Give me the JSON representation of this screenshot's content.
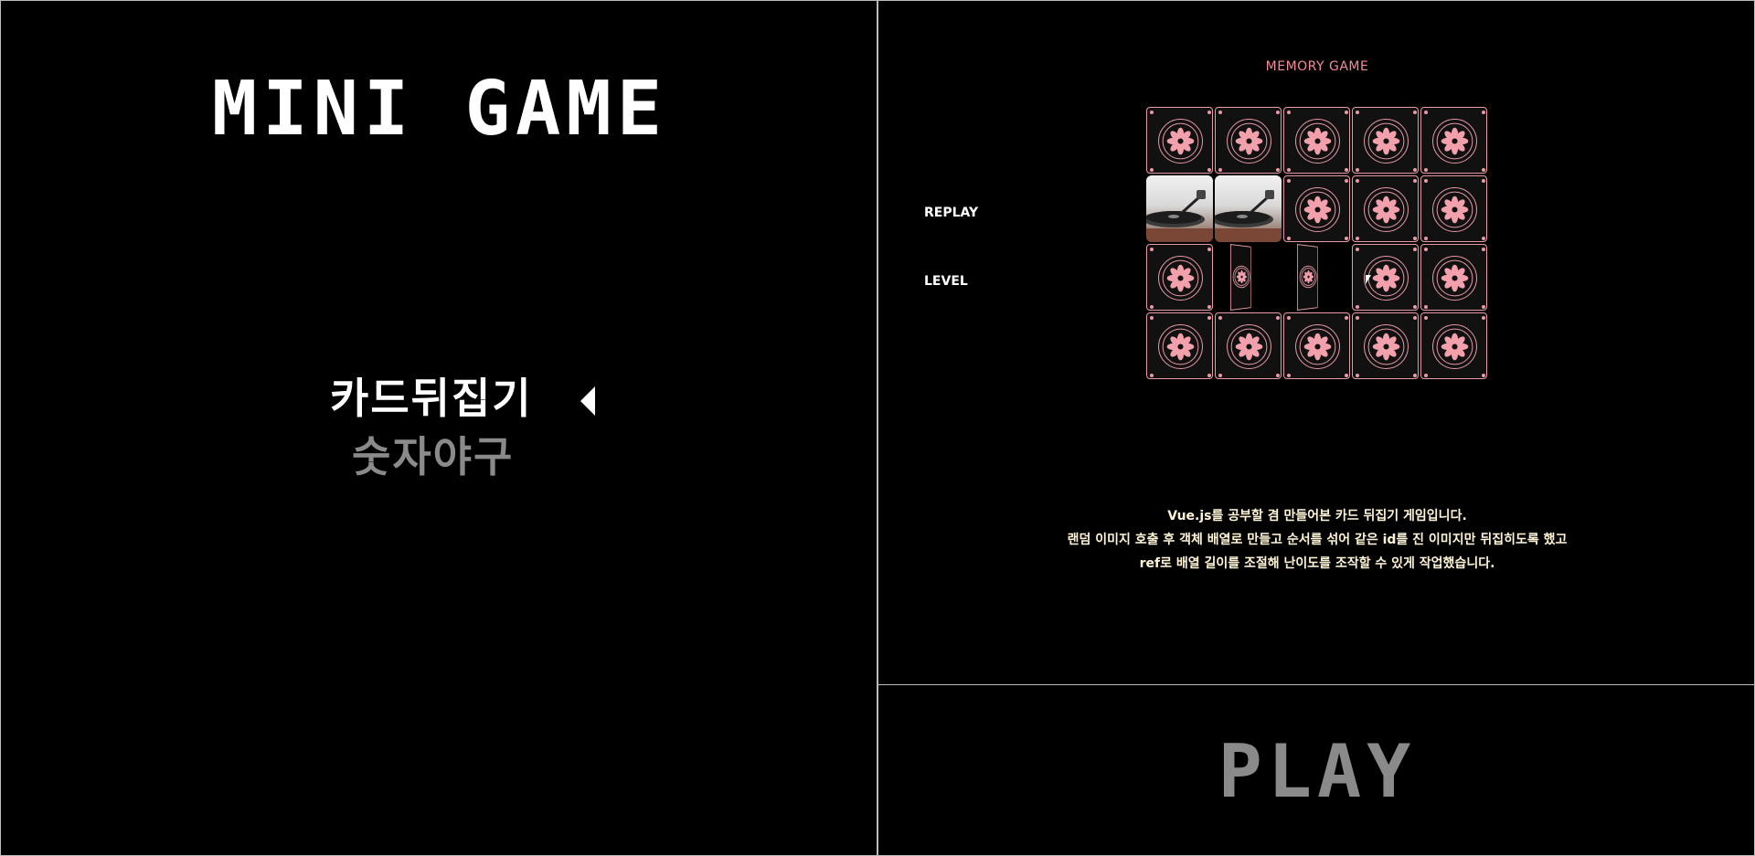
{
  "menu": {
    "title": "MINI GAME",
    "items": [
      {
        "label": "카드뒤집기",
        "selected": true
      },
      {
        "label": "숫자야구",
        "selected": false
      }
    ]
  },
  "game": {
    "title": "MEMORY GAME",
    "replay_label": "REPLAY",
    "level_label": "LEVEL",
    "grid": {
      "columns": 5,
      "rows": 4
    },
    "revealed_cards": [
      {
        "row": 2,
        "col": 1,
        "image": "turntable"
      },
      {
        "row": 2,
        "col": 2,
        "image": "turntable"
      }
    ],
    "flipping_cards": [
      {
        "row": 3,
        "col": 2
      },
      {
        "row": 3,
        "col": 3
      }
    ],
    "description": [
      "Vue.js를 공부할 겸 만들어본 카드 뒤집기 게임입니다.",
      "랜덤 이미지 호출 후 객체 배열로 만들고 순서를 섞어 같은 id를 진 이미지만 뒤집히도록 했고",
      "ref로 배열 길이를 조절해 난이도를 조작할 수 있게 작업했습니다."
    ],
    "colors": {
      "accent": "#f38b9b",
      "card_border": "#e89aa6",
      "description_text": "#fff5d6"
    }
  },
  "play": {
    "label": "PLAY"
  }
}
